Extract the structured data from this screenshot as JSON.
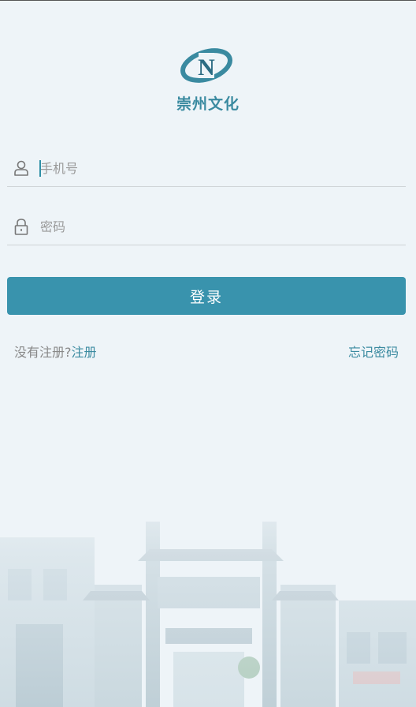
{
  "app": {
    "name": "崇州文化",
    "logo_letter": "N"
  },
  "form": {
    "phone_placeholder": "手机号",
    "password_placeholder": "密码",
    "login_label": "登录"
  },
  "links": {
    "no_account_text": "没有注册?",
    "register_label": "注册",
    "forgot_label": "忘记密码"
  },
  "colors": {
    "accent": "#3993ad",
    "background": "#eef4f8"
  },
  "icons": [
    "user-icon",
    "lock-icon"
  ]
}
